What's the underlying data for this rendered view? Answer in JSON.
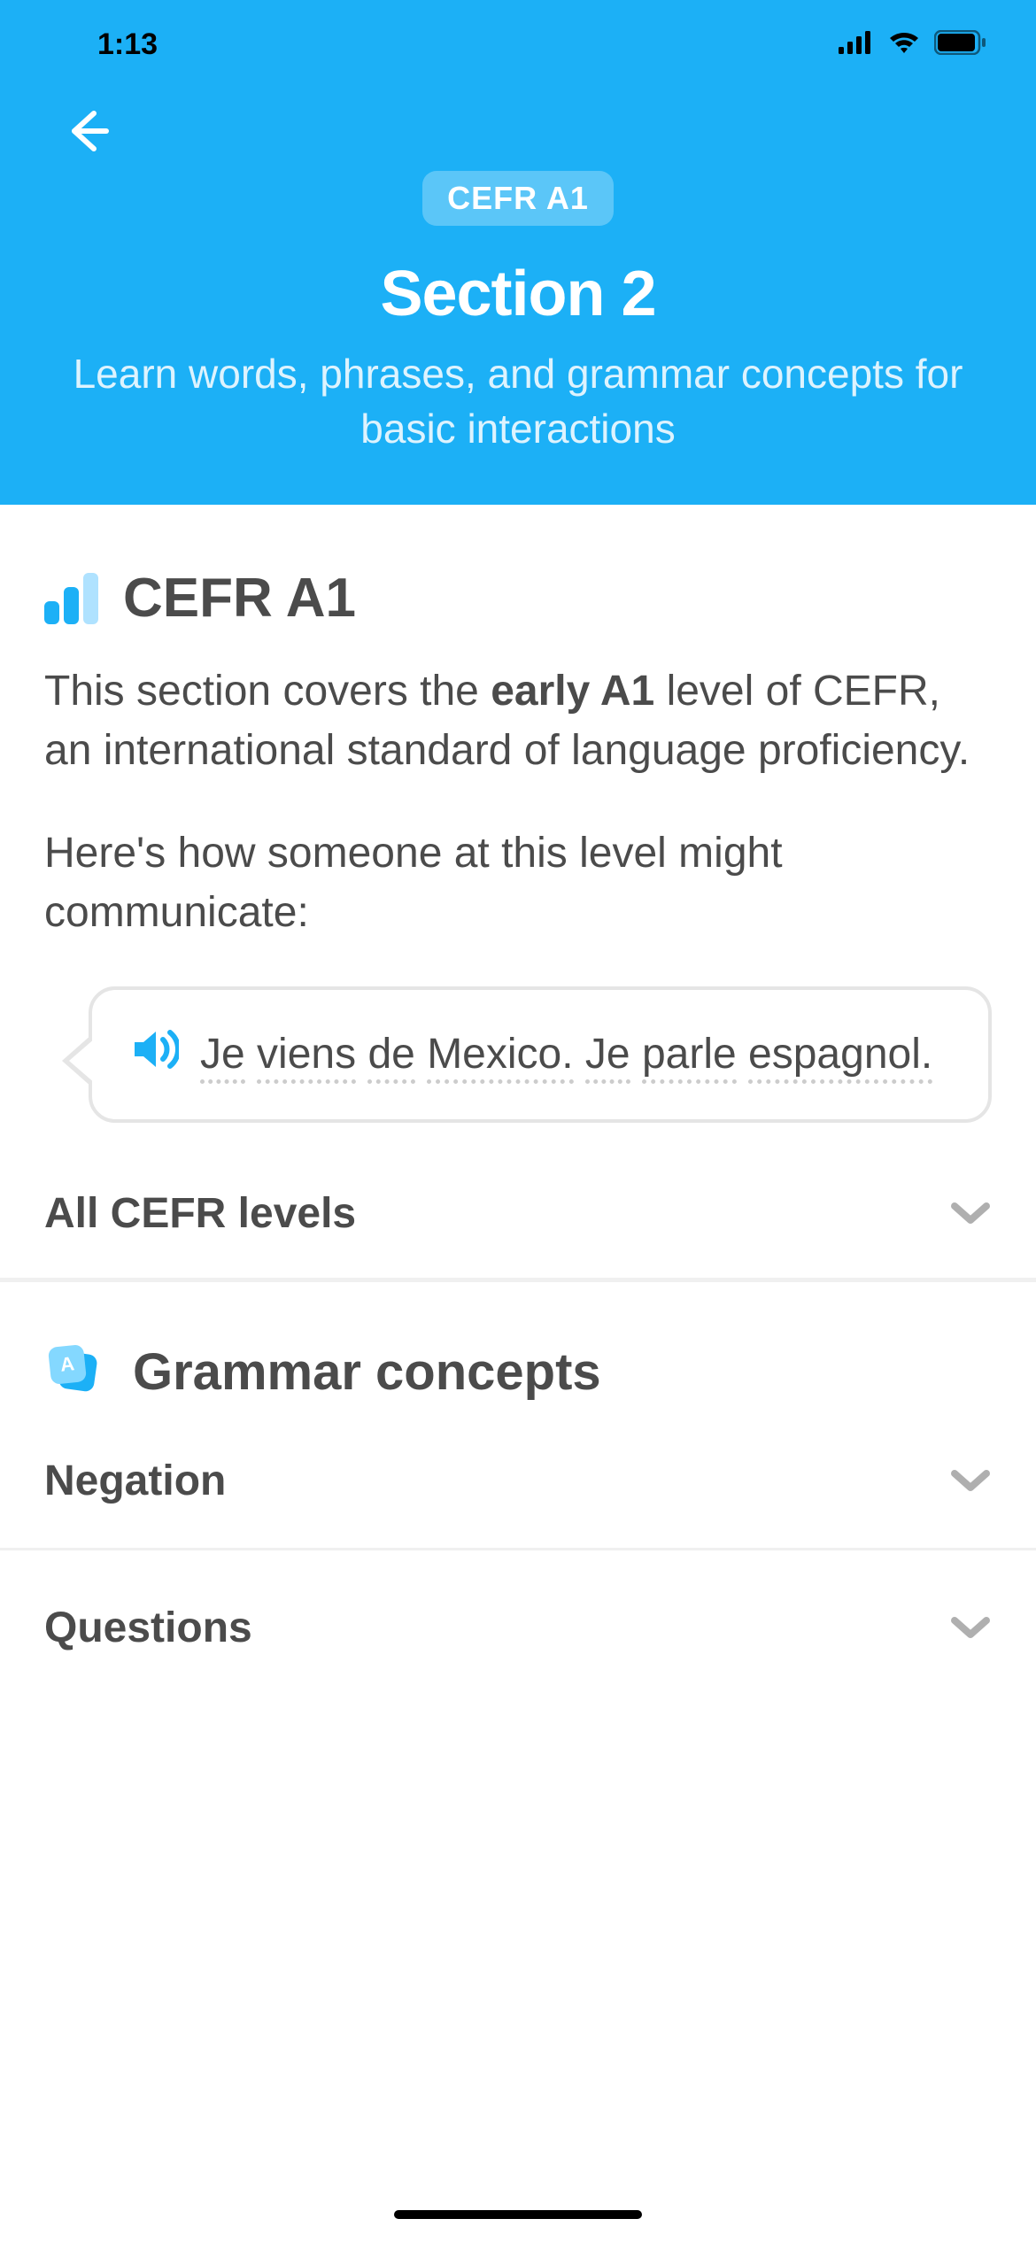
{
  "status": {
    "time": "1:13"
  },
  "header": {
    "badge": "CEFR A1",
    "title": "Section 2",
    "subtitle": "Learn words, phrases, and grammar concepts for basic interactions"
  },
  "cefr": {
    "heading": "CEFR A1",
    "description_prefix": "This section covers the ",
    "description_bold": "early A1",
    "description_suffix": " level of CEFR, an international standard of language proficiency.",
    "intro": "Here's how someone at this level might communicate:",
    "example_sentence": "Je viens de Mexico. Je parle espagnol.",
    "expander_label": "All CEFR levels"
  },
  "grammar": {
    "heading": "Grammar concepts",
    "items": [
      {
        "label": "Negation"
      },
      {
        "label": "Questions"
      }
    ]
  }
}
